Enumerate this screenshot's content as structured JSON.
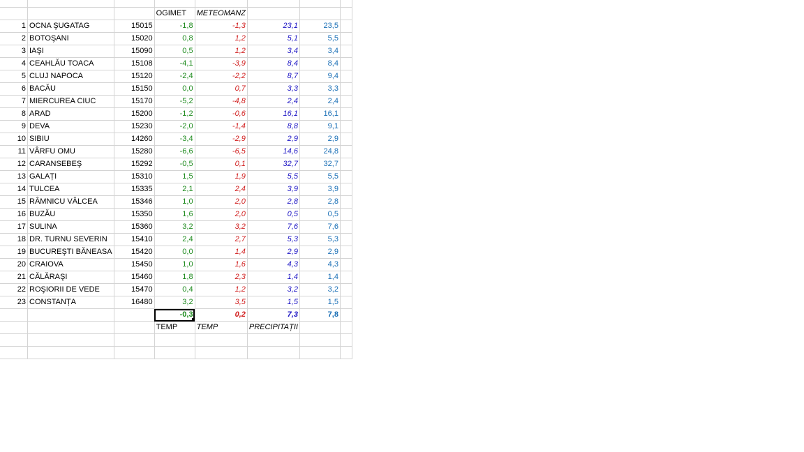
{
  "headers": {
    "ogimet": "OGIMET",
    "meteomanz": "METEOMANZ"
  },
  "footer": {
    "temp1": "TEMP",
    "temp2": "TEMP",
    "precip": "PRECIPITAȚII"
  },
  "totals": {
    "ogimet_temp": "-0,3",
    "meteomanz_temp": "0,2",
    "precip1": "7,3",
    "precip2": "7,8"
  },
  "rows": [
    {
      "n": "1",
      "name": "OCNA ŞUGATAG",
      "code": "15015",
      "t1": "-1,8",
      "t2": "-1,3",
      "p1": "23,1",
      "p2": "23,5"
    },
    {
      "n": "2",
      "name": "BOTOŞANI",
      "code": "15020",
      "t1": "0,8",
      "t2": "1,2",
      "p1": "5,1",
      "p2": "5,5"
    },
    {
      "n": "3",
      "name": "IAŞI",
      "code": "15090",
      "t1": "0,5",
      "t2": "1,2",
      "p1": "3,4",
      "p2": "3,4"
    },
    {
      "n": "4",
      "name": "CEAHLĂU TOACA",
      "code": "15108",
      "t1": "-4,1",
      "t2": "-3,9",
      "p1": "8,4",
      "p2": "8,4"
    },
    {
      "n": "5",
      "name": "CLUJ NAPOCA",
      "code": "15120",
      "t1": "-2,4",
      "t2": "-2,2",
      "p1": "8,7",
      "p2": "9,4"
    },
    {
      "n": "6",
      "name": "BACĂU",
      "code": "15150",
      "t1": "0,0",
      "t2": "0,7",
      "p1": "3,3",
      "p2": "3,3"
    },
    {
      "n": "7",
      "name": "MIERCUREA CIUC",
      "code": "15170",
      "t1": "-5,2",
      "t2": "-4,8",
      "p1": "2,4",
      "p2": "2,4"
    },
    {
      "n": "8",
      "name": "ARAD",
      "code": "15200",
      "t1": "-1,2",
      "t2": "-0,6",
      "p1": "16,1",
      "p2": "16,1"
    },
    {
      "n": "9",
      "name": "DEVA",
      "code": "15230",
      "t1": "-2,0",
      "t2": "-1,4",
      "p1": "8,8",
      "p2": "9,1"
    },
    {
      "n": "10",
      "name": "SIBIU",
      "code": "14260",
      "t1": "-3,4",
      "t2": "-2,9",
      "p1": "2,9",
      "p2": "2,9"
    },
    {
      "n": "11",
      "name": "VÂRFU OMU",
      "code": "15280",
      "t1": "-6,6",
      "t2": "-6,5",
      "p1": "14,6",
      "p2": "24,8"
    },
    {
      "n": "12",
      "name": "CARANSEBEŞ",
      "code": "15292",
      "t1": "-0,5",
      "t2": "0,1",
      "p1": "32,7",
      "p2": "32,7"
    },
    {
      "n": "13",
      "name": "GALAȚI",
      "code": "15310",
      "t1": "1,5",
      "t2": "1,9",
      "p1": "5,5",
      "p2": "5,5"
    },
    {
      "n": "14",
      "name": "TULCEA",
      "code": "15335",
      "t1": "2,1",
      "t2": "2,4",
      "p1": "3,9",
      "p2": "3,9"
    },
    {
      "n": "15",
      "name": "RÂMNICU VÂLCEA",
      "code": "15346",
      "t1": "1,0",
      "t2": "2,0",
      "p1": "2,8",
      "p2": "2,8"
    },
    {
      "n": "16",
      "name": "BUZĂU",
      "code": "15350",
      "t1": "1,6",
      "t2": "2,0",
      "p1": "0,5",
      "p2": "0,5"
    },
    {
      "n": "17",
      "name": "SULINA",
      "code": "15360",
      "t1": "3,2",
      "t2": "3,2",
      "p1": "7,6",
      "p2": "7,6"
    },
    {
      "n": "18",
      "name": "DR. TURNU SEVERIN",
      "code": "15410",
      "t1": "2,4",
      "t2": "2,7",
      "p1": "5,3",
      "p2": "5,3"
    },
    {
      "n": "19",
      "name": "BUCUREŞTI BĂNEASA",
      "code": "15420",
      "t1": "0,0",
      "t2": "1,4",
      "p1": "2,9",
      "p2": "2,9"
    },
    {
      "n": "20",
      "name": "CRAIOVA",
      "code": "15450",
      "t1": "1,0",
      "t2": "1,6",
      "p1": "4,3",
      "p2": "4,3"
    },
    {
      "n": "21",
      "name": "CĂLĂRAŞI",
      "code": "15460",
      "t1": "1,8",
      "t2": "2,3",
      "p1": "1,4",
      "p2": "1,4"
    },
    {
      "n": "22",
      "name": "ROŞIORII DE VEDE",
      "code": "15470",
      "t1": "0,4",
      "t2": "1,2",
      "p1": "3,2",
      "p2": "3,2"
    },
    {
      "n": "23",
      "name": "CONSTANȚA",
      "code": "16480",
      "t1": "3,2",
      "t2": "3,5",
      "p1": "1,5",
      "p2": "1,5"
    }
  ],
  "colors": {
    "ogimet": "#1e8b1e",
    "meteomanz": "#d11f1f",
    "precip1": "#1c14c4",
    "precip2": "#1a6fb6",
    "gridline": "#d4d4d4"
  }
}
